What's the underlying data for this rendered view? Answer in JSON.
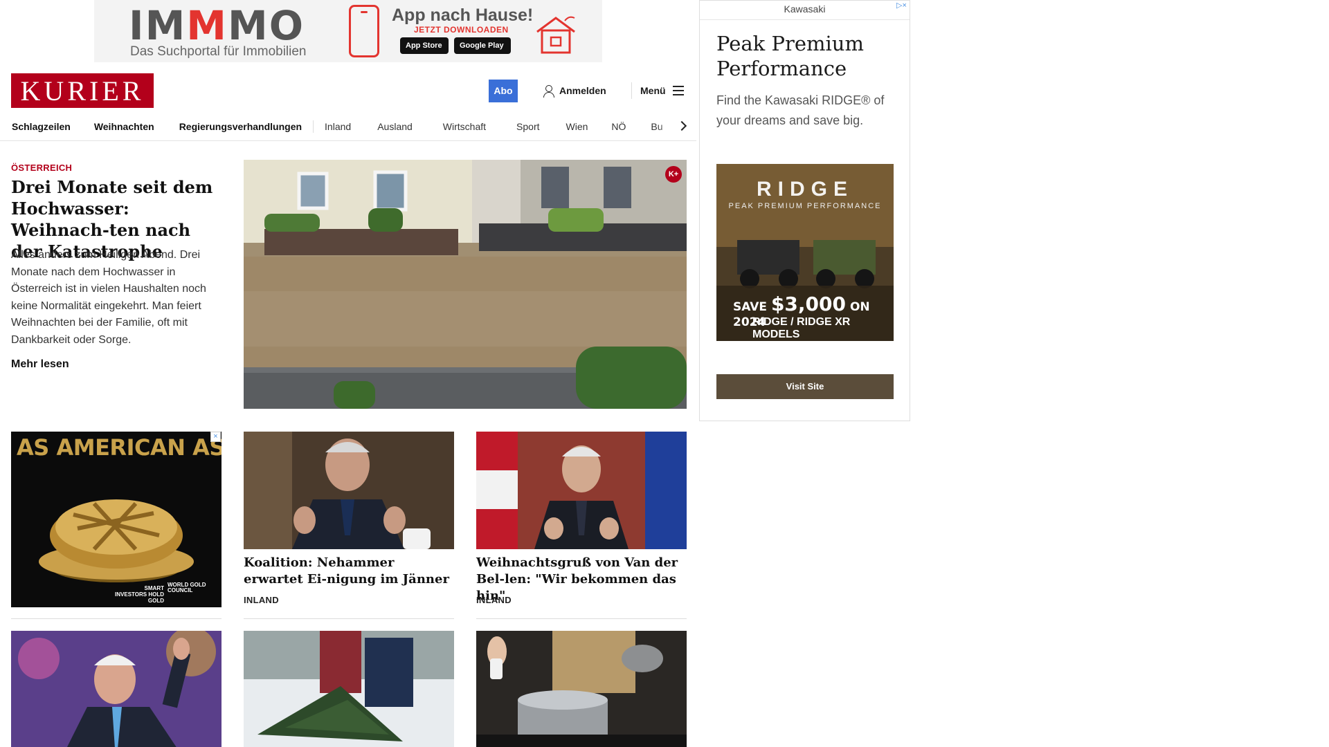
{
  "top_ad": {
    "brand": "IMMMO",
    "tagline": "Das Suchportal für Immobilien",
    "headline": "App nach Hause!",
    "cta": "JETZT DOWNLOADEN",
    "app_store": "App Store",
    "google_play": "Google Play"
  },
  "header": {
    "logo": "KURIER",
    "abo_label": "Abo",
    "login_label": "Anmelden",
    "menu_label": "Menü"
  },
  "nav": {
    "items": [
      "Schlagzeilen",
      "Weihnachten",
      "Regierungsverhandlungen",
      "Inland",
      "Ausland",
      "Wirtschaft",
      "Sport",
      "Wien",
      "NÖ",
      "Bu"
    ]
  },
  "lead": {
    "kicker": "ÖSTERREICH",
    "title": "Drei Monate seit dem Hochwasser: Weihnach-ten nach der Katastrophe",
    "teaser": "Alles anders zum Heiligen Abend. Drei Monate nach dem Hochwasser in Österreich ist in vielen Haushalten noch keine Normalität eingekehrt. Man feiert Weihnachten bei der Familie, oft mit Dankbarkeit oder Sorge.",
    "more_label": "Mehr lesen",
    "badge": "K+"
  },
  "inline_ad": {
    "headline": "AS AMERICAN AS",
    "footer": "SMART INVESTORS HOLD GOLD",
    "sponsor": "WORLD GOLD COUNCIL"
  },
  "cards": [
    {
      "title": "Koalition: Nehammer erwartet Ei-nigung im Jänner",
      "category": "INLAND"
    },
    {
      "title": "Weihnachtsgruß von Van der Bel-len: \"Wir bekommen das hin\"",
      "category": "INLAND"
    }
  ],
  "side_ad": {
    "brand": "Kawasaki",
    "headline": "Peak Premium Performance",
    "body": "Find the Kawasaki RIDGE® of your dreams and save big.",
    "image_logo": "RIDGE",
    "image_tag": "PEAK PREMIUM PERFORMANCE",
    "image_save": "SAVE",
    "image_amount": "$3,000",
    "image_on": "ON 2024",
    "image_models": "RIDGE / RIDGE XR MODELS",
    "cta": "Visit Site"
  }
}
